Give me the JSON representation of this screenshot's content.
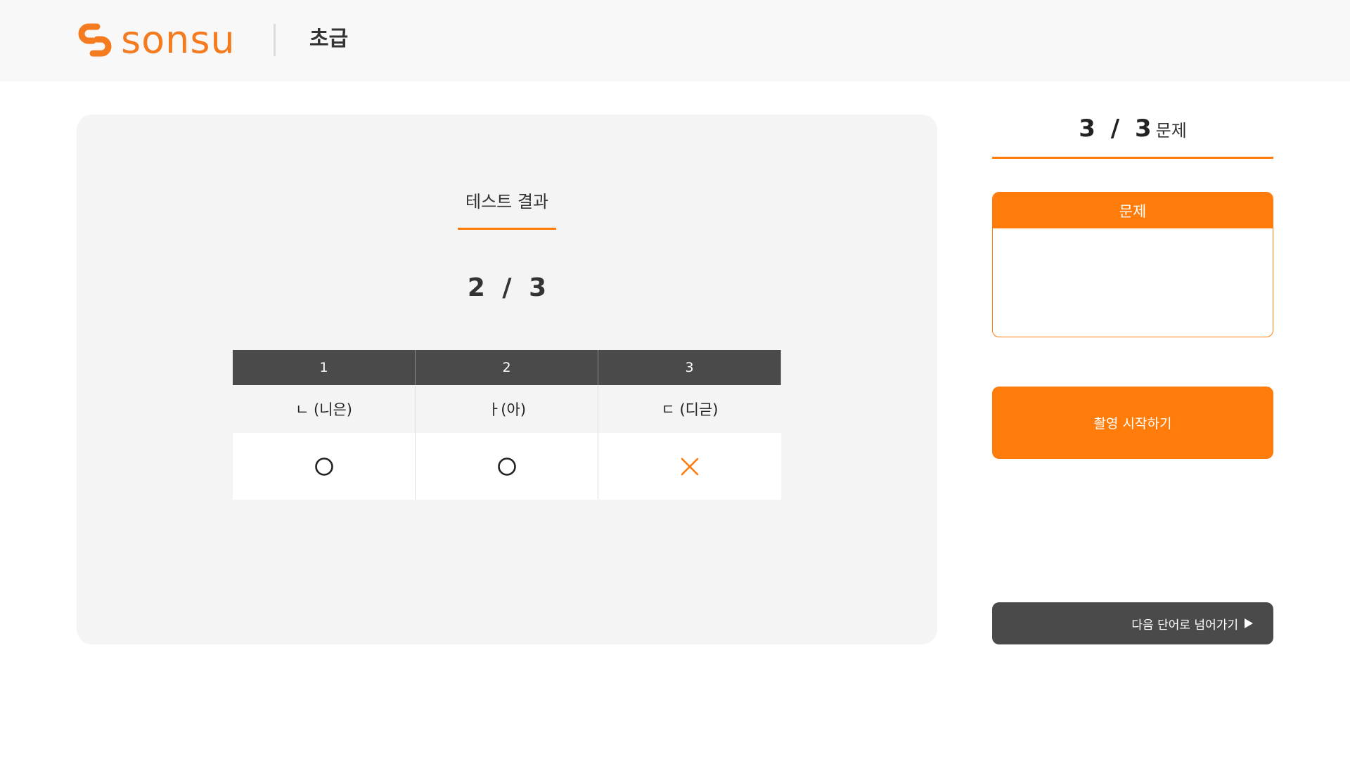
{
  "header": {
    "logo_text": "sonsu",
    "level": "초급"
  },
  "result": {
    "title": "테스트 결과",
    "score": "2 / 3"
  },
  "table": {
    "headers": [
      "1",
      "2",
      "3"
    ],
    "words": [
      "ㄴ (니은)",
      "ㅏ(아)",
      "ㄷ (디귿)"
    ],
    "marks": [
      "circle-icon",
      "circle-icon",
      "x-icon"
    ]
  },
  "panel": {
    "progress_nums": "3 / 3",
    "progress_unit": "문제",
    "question_label": "문제",
    "record_label": "촬영 시작하기",
    "next_label": "다음 단어로 넘어가기"
  },
  "colors": {
    "accent": "#ff7b0a",
    "dark": "#4a4a4a",
    "card_bg": "#f4f4f4",
    "header_bg": "#f8f8f8"
  }
}
